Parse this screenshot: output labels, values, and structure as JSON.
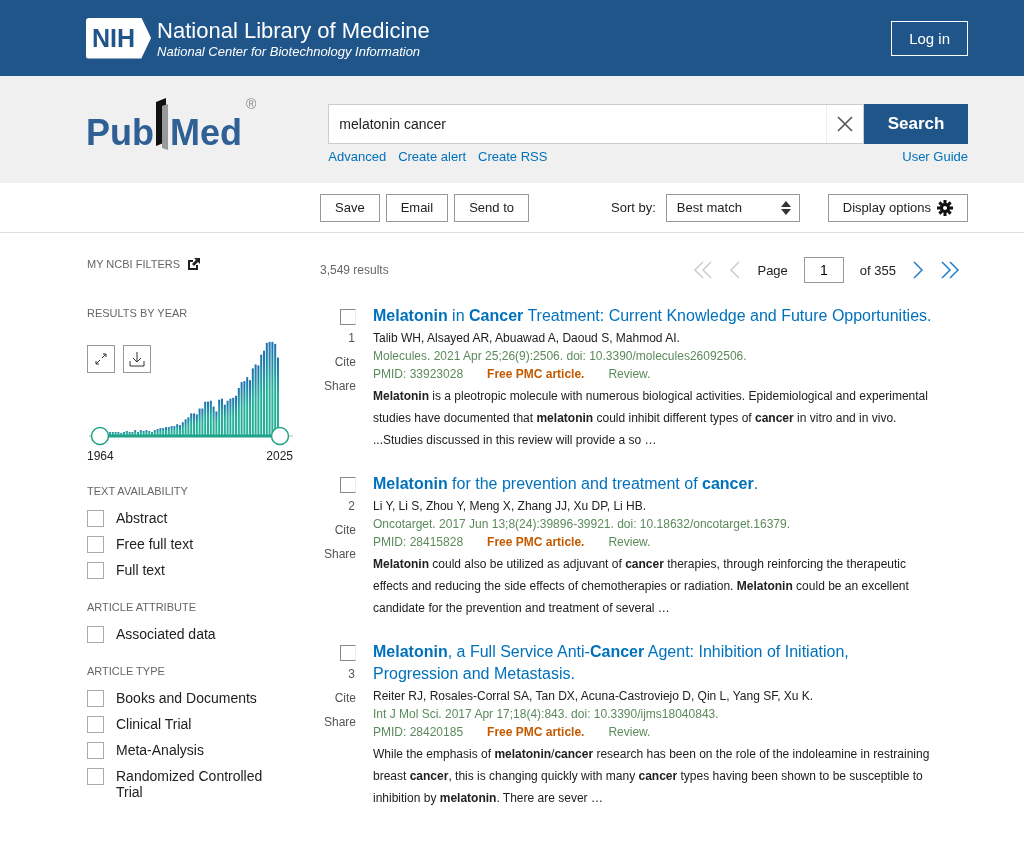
{
  "header": {
    "logo_text": "NIH",
    "title": "National Library of Medicine",
    "subtitle": "National Center for Biotechnology Information",
    "login": "Log in"
  },
  "search": {
    "logo_left": "Pub",
    "logo_right": "Med",
    "logo_mark": "®",
    "value": "melatonin cancer",
    "button": "Search",
    "links": [
      "Advanced",
      "Create alert",
      "Create RSS"
    ],
    "user_guide": "User Guide"
  },
  "toolbar": {
    "buttons": [
      "Save",
      "Email",
      "Send to"
    ],
    "sort_label": "Sort by:",
    "sort_value": "Best match",
    "display_options": "Display options"
  },
  "sidebar": {
    "my_filters": "MY NCBI FILTERS",
    "results_by_year": "RESULTS BY YEAR",
    "year_start": "1964",
    "year_end": "2025",
    "groups": [
      {
        "title": "TEXT AVAILABILITY",
        "items": [
          {
            "label": "Abstract",
            "checked": false
          },
          {
            "label": "Free full text",
            "checked": false
          },
          {
            "label": "Full text",
            "checked": false
          }
        ]
      },
      {
        "title": "ARTICLE ATTRIBUTE",
        "items": [
          {
            "label": "Associated data",
            "checked": false
          }
        ]
      },
      {
        "title": "ARTICLE TYPE",
        "items": [
          {
            "label": "Books and Documents",
            "checked": false
          },
          {
            "label": "Clinical Trial",
            "checked": false
          },
          {
            "label": "Meta-Analysis",
            "checked": false
          },
          {
            "label": "Randomized Controlled Trial",
            "checked": false
          }
        ]
      }
    ]
  },
  "results": {
    "count": "3,549 results",
    "page_label": "Page",
    "page": "1",
    "of_pages": "of 355",
    "items": [
      {
        "number": "1",
        "checked": false,
        "cite": "Cite",
        "share": "Share",
        "title": "**Melatonin** in **Cancer** Treatment: Current Knowledge and Future Opportunities.",
        "authors": "Talib WH, Alsayed AR, Abuawad A, Daoud S, Mahmod AI.",
        "citation": "Molecules. 2021 Apr 25;26(9):2506. doi: 10.3390/molecules26092506.",
        "pmid": "PMID: 33923028",
        "free": "Free PMC article.",
        "type": "Review.",
        "snippet": "**Melatonin** is a pleotropic molecule with numerous biological activities. Epidemiological and experimental studies have documented that **melatonin** could inhibit different types of **cancer** in vitro and in vivo. ...Studies discussed in this review will provide a so …"
      },
      {
        "number": "2",
        "checked": false,
        "cite": "Cite",
        "share": "Share",
        "title": "**Melatonin** for the prevention and treatment of **cancer**.",
        "authors": "Li Y, Li S, Zhou Y, Meng X, Zhang JJ, Xu DP, Li HB.",
        "citation": "Oncotarget. 2017 Jun 13;8(24):39896-39921. doi: 10.18632/oncotarget.16379.",
        "pmid": "PMID: 28415828",
        "free": "Free PMC article.",
        "type": "Review.",
        "snippet": "**Melatonin** could also be utilized as adjuvant of **cancer** therapies, through reinforcing the therapeutic effects and reducing the side effects of chemotherapies or radiation. **Melatonin** could be an excellent candidate for the prevention and treatment of several …"
      },
      {
        "number": "3",
        "checked": false,
        "cite": "Cite",
        "share": "Share",
        "title": "**Melatonin**, a Full Service Anti-**Cancer** Agent: Inhibition of Initiation, Progression and Metastasis.",
        "authors": "Reiter RJ, Rosales-Corral SA, Tan DX, Acuna-Castroviejo D, Qin L, Yang SF, Xu K.",
        "citation": "Int J Mol Sci. 2017 Apr 17;18(4):843. doi: 10.3390/ijms18040843.",
        "pmid": "PMID: 28420185",
        "free": "Free PMC article.",
        "type": "Review.",
        "snippet": "While the emphasis of **melatonin**/**cancer** research has been on the role of the indoleamine in restraining breast **cancer**, this is changing quickly with many **cancer** types having been shown to be susceptible to inhibition by **melatonin**. There are sever …"
      }
    ]
  }
}
